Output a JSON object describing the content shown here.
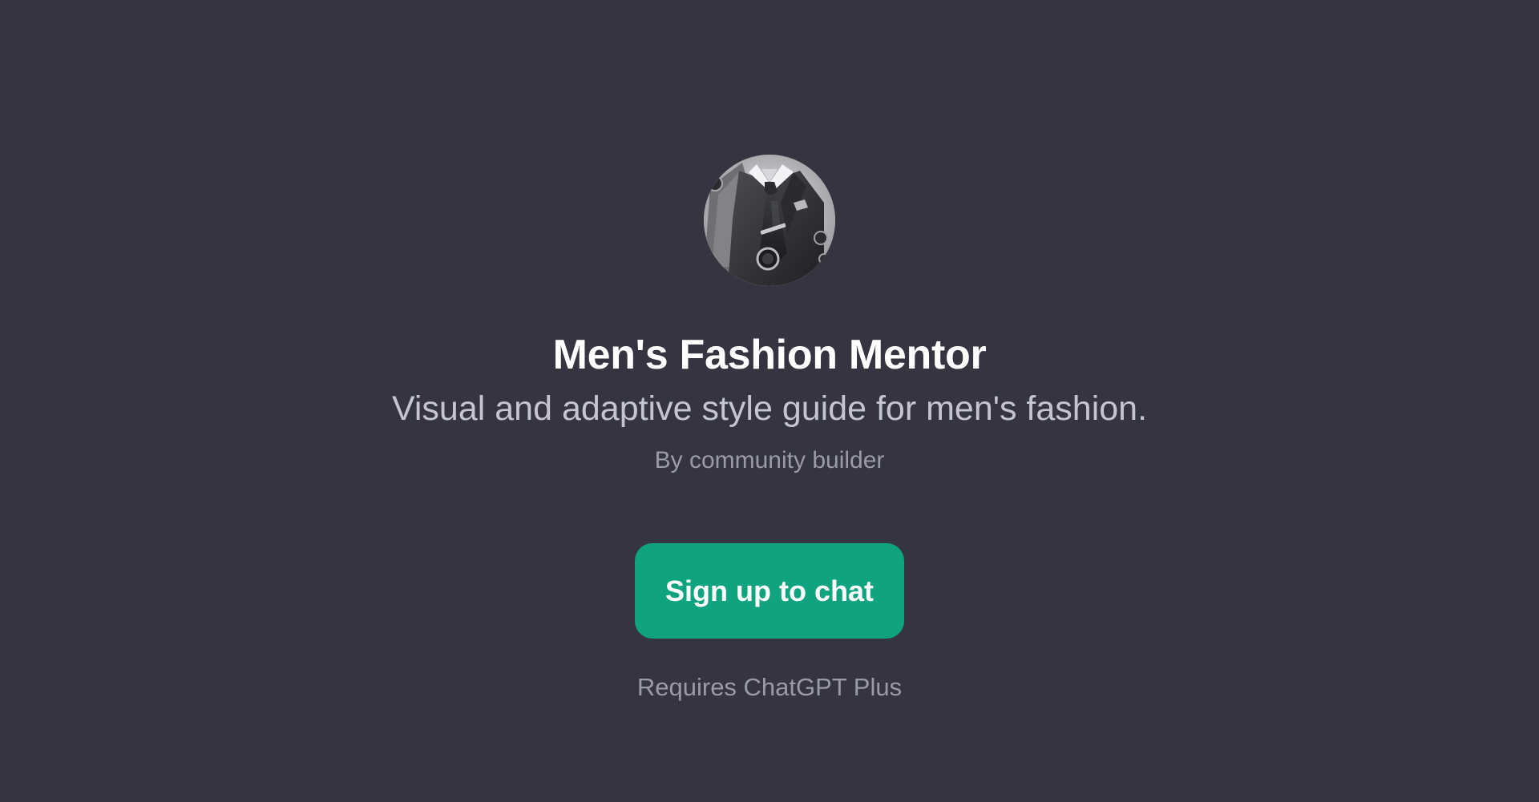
{
  "gpt": {
    "avatar_icon": "suit-and-tie-avatar",
    "title": "Men's Fashion Mentor",
    "description": "Visual and adaptive style guide for men's fashion.",
    "author": "By community builder"
  },
  "cta": {
    "label": "Sign up to chat"
  },
  "requirement": "Requires ChatGPT Plus",
  "colors": {
    "background": "#343541",
    "accent": "#10a37f",
    "title": "#ffffff",
    "subtitle": "#c5c5d2",
    "muted": "#9b9ba8"
  }
}
